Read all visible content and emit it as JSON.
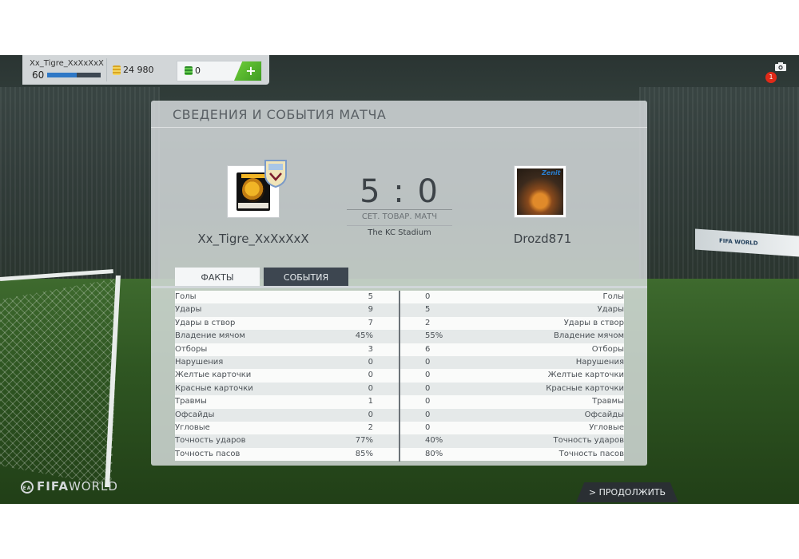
{
  "user": {
    "name": "Xx_Tigre_XxXxXxX",
    "level": "60",
    "xp_progress": 0.55,
    "coins": "24 980",
    "points": "0",
    "add_label": "+"
  },
  "notifications": {
    "count": "1"
  },
  "panel": {
    "title": "СВЕДЕНИЯ И СОБЫТИЯ МАТЧА"
  },
  "match": {
    "home_name": "Xx_Tigre_XxXxXxX",
    "away_name": "Drozd871",
    "score": "5 : 0",
    "match_type": "СЕТ. ТОВАР. МАТЧ",
    "stadium": "The KC Stadium"
  },
  "home_crest": {
    "top_text": "xXx_Tigre_Xx",
    "year": "2015"
  },
  "away_crest": {
    "badge_text": "Zenit"
  },
  "tabs": {
    "facts": "ФАКТЫ",
    "events": "СОБЫТИЯ"
  },
  "stats": [
    {
      "label": "Голы",
      "home": "5",
      "away": "0"
    },
    {
      "label": "Удары",
      "home": "9",
      "away": "5"
    },
    {
      "label": "Удары в створ",
      "home": "7",
      "away": "2"
    },
    {
      "label": "Владение мячом",
      "home": "45%",
      "away": "55%"
    },
    {
      "label": "Отборы",
      "home": "3",
      "away": "6"
    },
    {
      "label": "Нарушения",
      "home": "0",
      "away": "0"
    },
    {
      "label": "Желтые карточки",
      "home": "0",
      "away": "0"
    },
    {
      "label": "Красные карточки",
      "home": "0",
      "away": "0"
    },
    {
      "label": "Травмы",
      "home": "1",
      "away": "0"
    },
    {
      "label": "Офсайды",
      "home": "0",
      "away": "0"
    },
    {
      "label": "Угловые",
      "home": "2",
      "away": "0"
    },
    {
      "label": "Точность ударов",
      "home": "77%",
      "away": "40%"
    },
    {
      "label": "Точность пасов",
      "home": "85%",
      "away": "80%"
    }
  ],
  "footer": {
    "logo_bold": "FIFA",
    "logo_light": "WORLD",
    "logo_ea": "EA",
    "continue_label": "> ПРОДОЛЖИТЬ"
  },
  "ad_board": {
    "text": "FIFA WORLD"
  }
}
